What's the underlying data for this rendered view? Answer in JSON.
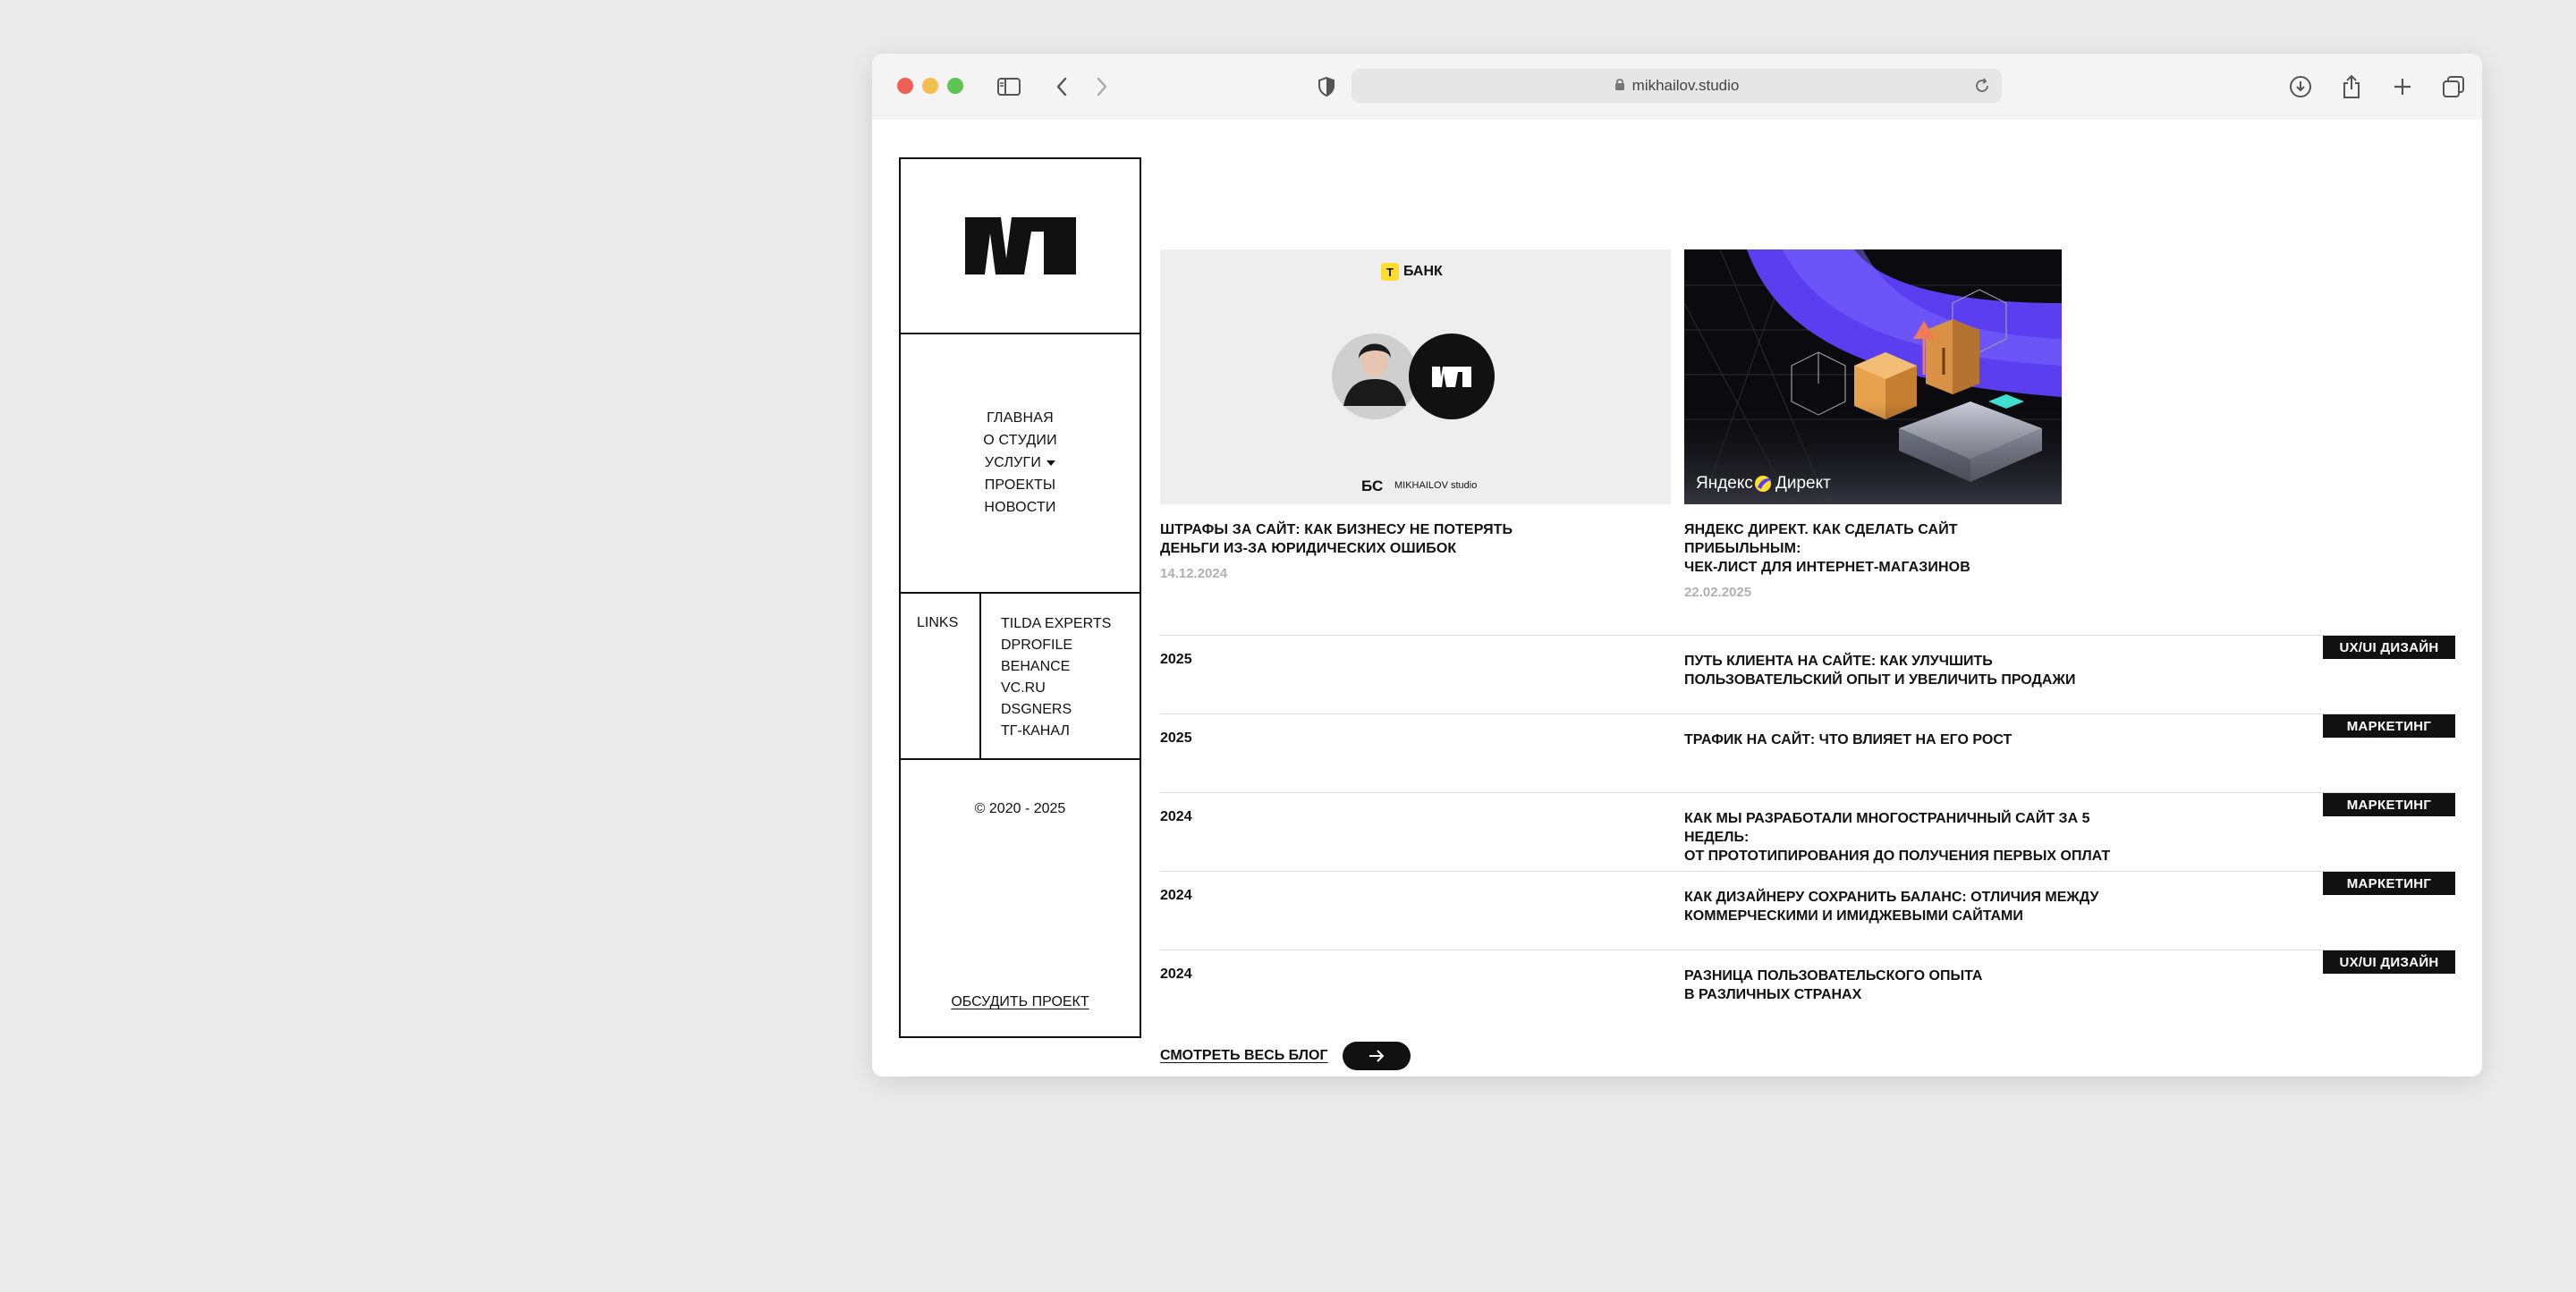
{
  "browser": {
    "url": "mikhailov.studio"
  },
  "sidebar": {
    "nav": [
      {
        "label": "ГЛАВНАЯ"
      },
      {
        "label": "О СТУДИИ"
      },
      {
        "label": "УСЛУГИ"
      },
      {
        "label": "ПРОЕКТЫ"
      },
      {
        "label": "НОВОСТИ"
      }
    ],
    "links_label": "LINKS",
    "links": [
      "TILDA EXPERTS",
      "DPROFILE",
      "BEHANCE",
      "VC.RU",
      "DSGNERS",
      "ТГ-КАНАЛ"
    ],
    "copyright": "© 2020 - 2025",
    "discuss_label": "ОБСУДИТЬ ПРОЕКТ"
  },
  "featured": [
    {
      "title_line1": "ШТРАФЫ ЗА САЙТ: КАК БИЗНЕСУ НЕ ПОТЕРЯТЬ",
      "title_line2": "ДЕНЬГИ ИЗ-ЗА ЮРИДИЧЕСКИХ ОШИБОК",
      "date": "14.12.2024",
      "thumb": {
        "brand_badge": "Т",
        "brand": "БАНК",
        "footer_mark": "БС",
        "footer_text": "MIKHAILOV studio"
      }
    },
    {
      "title_line1": "ЯНДЕКС ДИРЕКТ. КАК СДЕЛАТЬ САЙТ ПРИБЫЛЬНЫМ:",
      "title_line2": "ЧЕК-ЛИСТ ДЛЯ ИНТЕРНЕТ-МАГАЗИНОВ",
      "date": "22.02.2025",
      "thumb": {
        "brand_left": "Яндекс",
        "brand_right": "Директ"
      }
    }
  ],
  "posts": [
    {
      "year": "2025",
      "title_line1": "ПУТЬ КЛИЕНТА НА САЙТЕ: КАК УЛУЧШИТЬ",
      "title_line2": "ПОЛЬЗОВАТЕЛЬСКИЙ ОПЫТ И УВЕЛИЧИТЬ ПРОДАЖИ",
      "tag": "UX/UI ДИЗАЙН"
    },
    {
      "year": "2025",
      "title_line1": "ТРАФИК НА САЙТ: ЧТО ВЛИЯЕТ НА ЕГО РОСТ",
      "title_line2": "",
      "tag": "МАРКЕТИНГ"
    },
    {
      "year": "2024",
      "title_line1": "КАК МЫ РАЗРАБОТАЛИ МНОГОСТРАНИЧНЫЙ САЙТ ЗА 5 НЕДЕЛЬ:",
      "title_line2": "ОТ ПРОТОТИПИРОВАНИЯ ДО ПОЛУЧЕНИЯ ПЕРВЫХ ОПЛАТ",
      "tag": "МАРКЕТИНГ"
    },
    {
      "year": "2024",
      "title_line1": "КАК ДИЗАЙНЕРУ СОХРАНИТЬ БАЛАНС: ОТЛИЧИЯ МЕЖДУ",
      "title_line2": "КОММЕРЧЕСКИМИ И ИМИДЖЕВЫМИ САЙТАМИ",
      "tag": "МАРКЕТИНГ"
    },
    {
      "year": "2024",
      "title_line1": "РАЗНИЦА ПОЛЬЗОВАТЕЛЬСКОГО ОПЫТА",
      "title_line2": "В РАЗЛИЧНЫХ СТРАНАХ",
      "tag": "UX/UI ДИЗАЙН"
    }
  ],
  "view_all_label": "СМОТРЕТЬ ВЕСЬ БЛОГ",
  "icons": {
    "sidebar_toggle": "sidebar-icon",
    "back": "chevron-left-icon",
    "forward": "chevron-right-icon",
    "privacy": "shield-icon",
    "lock": "lock-icon",
    "reload": "reload-icon",
    "download": "download-icon",
    "share": "share-icon",
    "new_tab": "plus-icon",
    "tabs": "tabs-icon",
    "arrow": "arrow-right-icon"
  },
  "colors": {
    "close": "#ed5f57",
    "minimize": "#f5bd4f",
    "zoom": "#5fc454",
    "tbank_yellow": "#ffdd2d",
    "direct_purple": "#5a3ef0"
  }
}
